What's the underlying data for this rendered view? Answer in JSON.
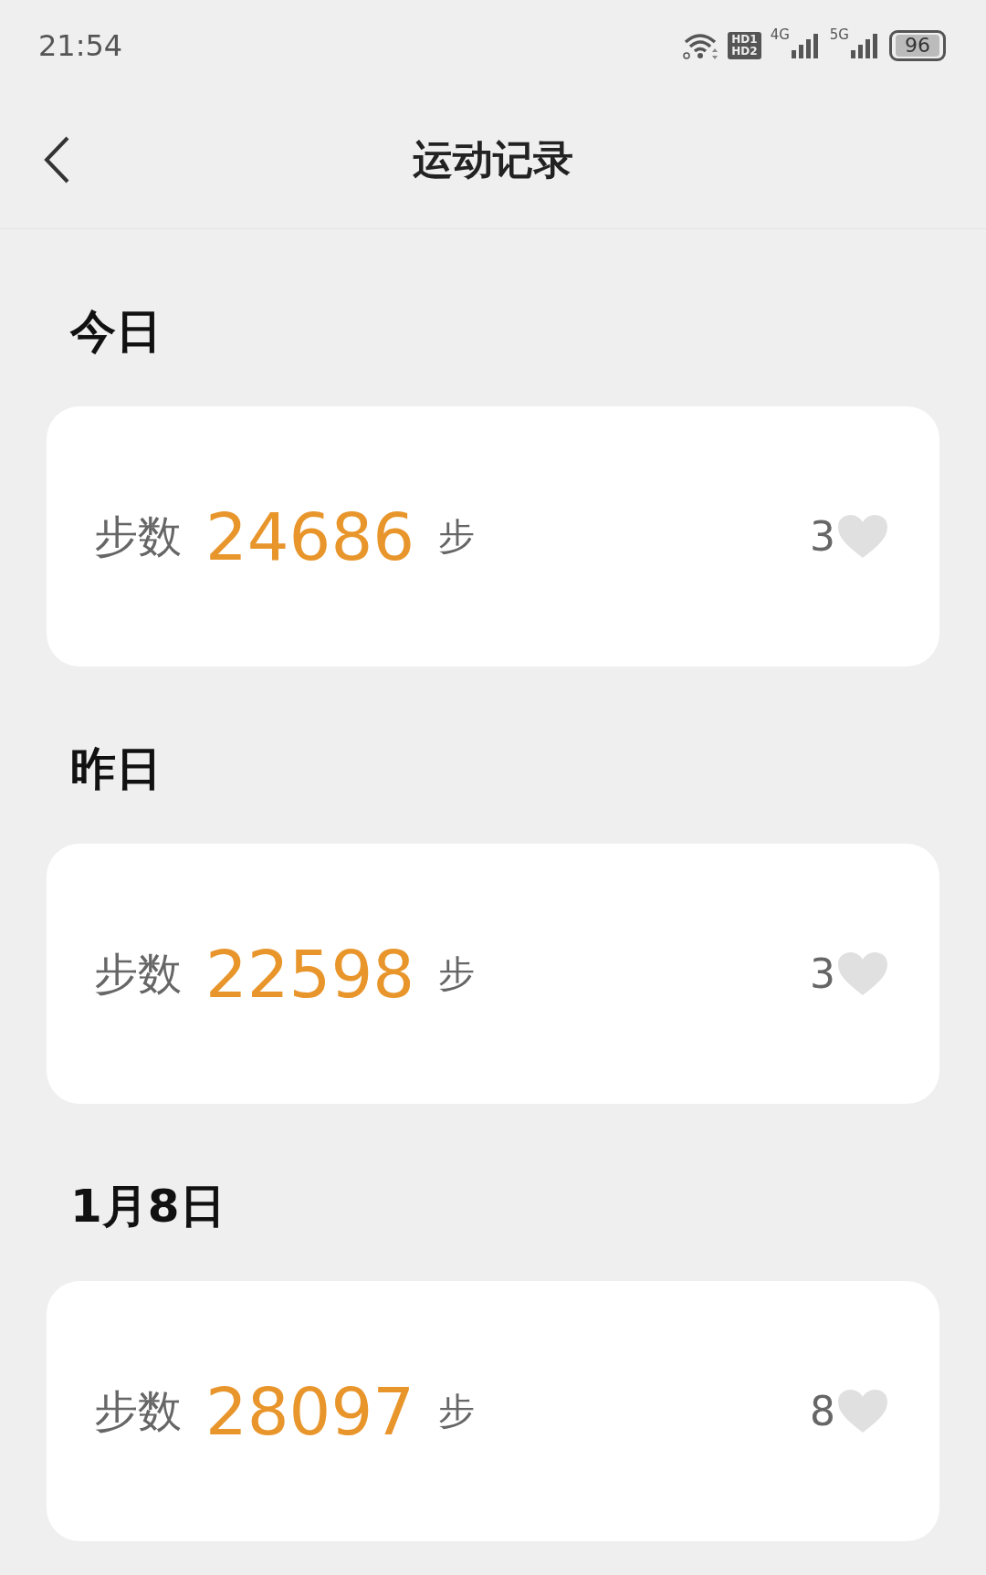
{
  "status_bar": {
    "time": "21:54",
    "hd_badge": [
      "HD1",
      "HD2"
    ],
    "signals": [
      {
        "label": "4G"
      },
      {
        "label": "5G"
      }
    ],
    "battery": "96"
  },
  "nav": {
    "title": "运动记录"
  },
  "records": [
    {
      "date": "今日",
      "label": "步数",
      "steps": "24686",
      "unit": "步",
      "likes": "3"
    },
    {
      "date": "昨日",
      "label": "步数",
      "steps": "22598",
      "unit": "步",
      "likes": "3"
    },
    {
      "date": "1月8日",
      "label": "步数",
      "steps": "28097",
      "unit": "步",
      "likes": "8"
    }
  ]
}
